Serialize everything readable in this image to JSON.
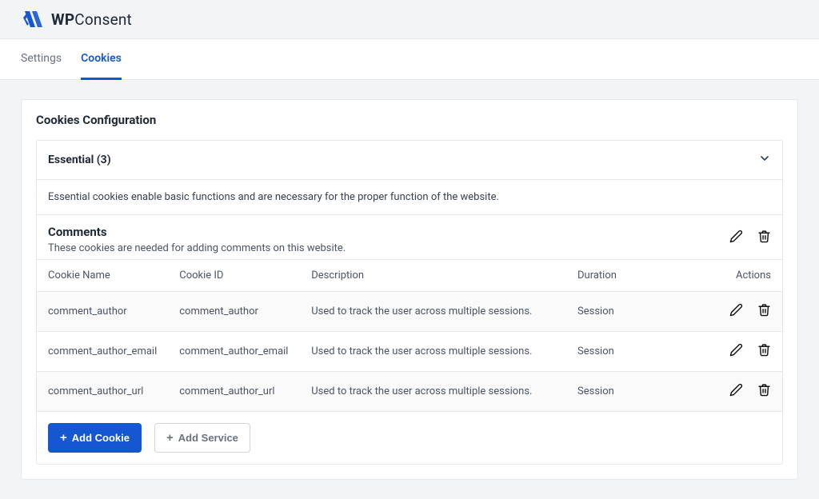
{
  "brand": {
    "name_bold": "WP",
    "name_light": "Consent"
  },
  "tabs": {
    "settings": "Settings",
    "cookies": "Cookies"
  },
  "panel": {
    "title": "Cookies Configuration"
  },
  "section": {
    "title": "Essential (3)",
    "description": "Essential cookies enable basic functions and are necessary for the proper function of the website."
  },
  "group": {
    "title": "Comments",
    "subtitle": "These cookies are needed for adding comments on this website."
  },
  "table": {
    "headers": {
      "name": "Cookie Name",
      "id": "Cookie ID",
      "description": "Description",
      "duration": "Duration",
      "actions": "Actions"
    },
    "rows": [
      {
        "name": "comment_author",
        "id": "comment_author",
        "description": "Used to track the user across multiple sessions.",
        "duration": "Session"
      },
      {
        "name": "comment_author_email",
        "id": "comment_author_email",
        "description": "Used to track the user across multiple sessions.",
        "duration": "Session"
      },
      {
        "name": "comment_author_url",
        "id": "comment_author_url",
        "description": "Used to track the user across multiple sessions.",
        "duration": "Session"
      }
    ]
  },
  "buttons": {
    "add_cookie": "Add Cookie",
    "add_service": "Add Service"
  }
}
